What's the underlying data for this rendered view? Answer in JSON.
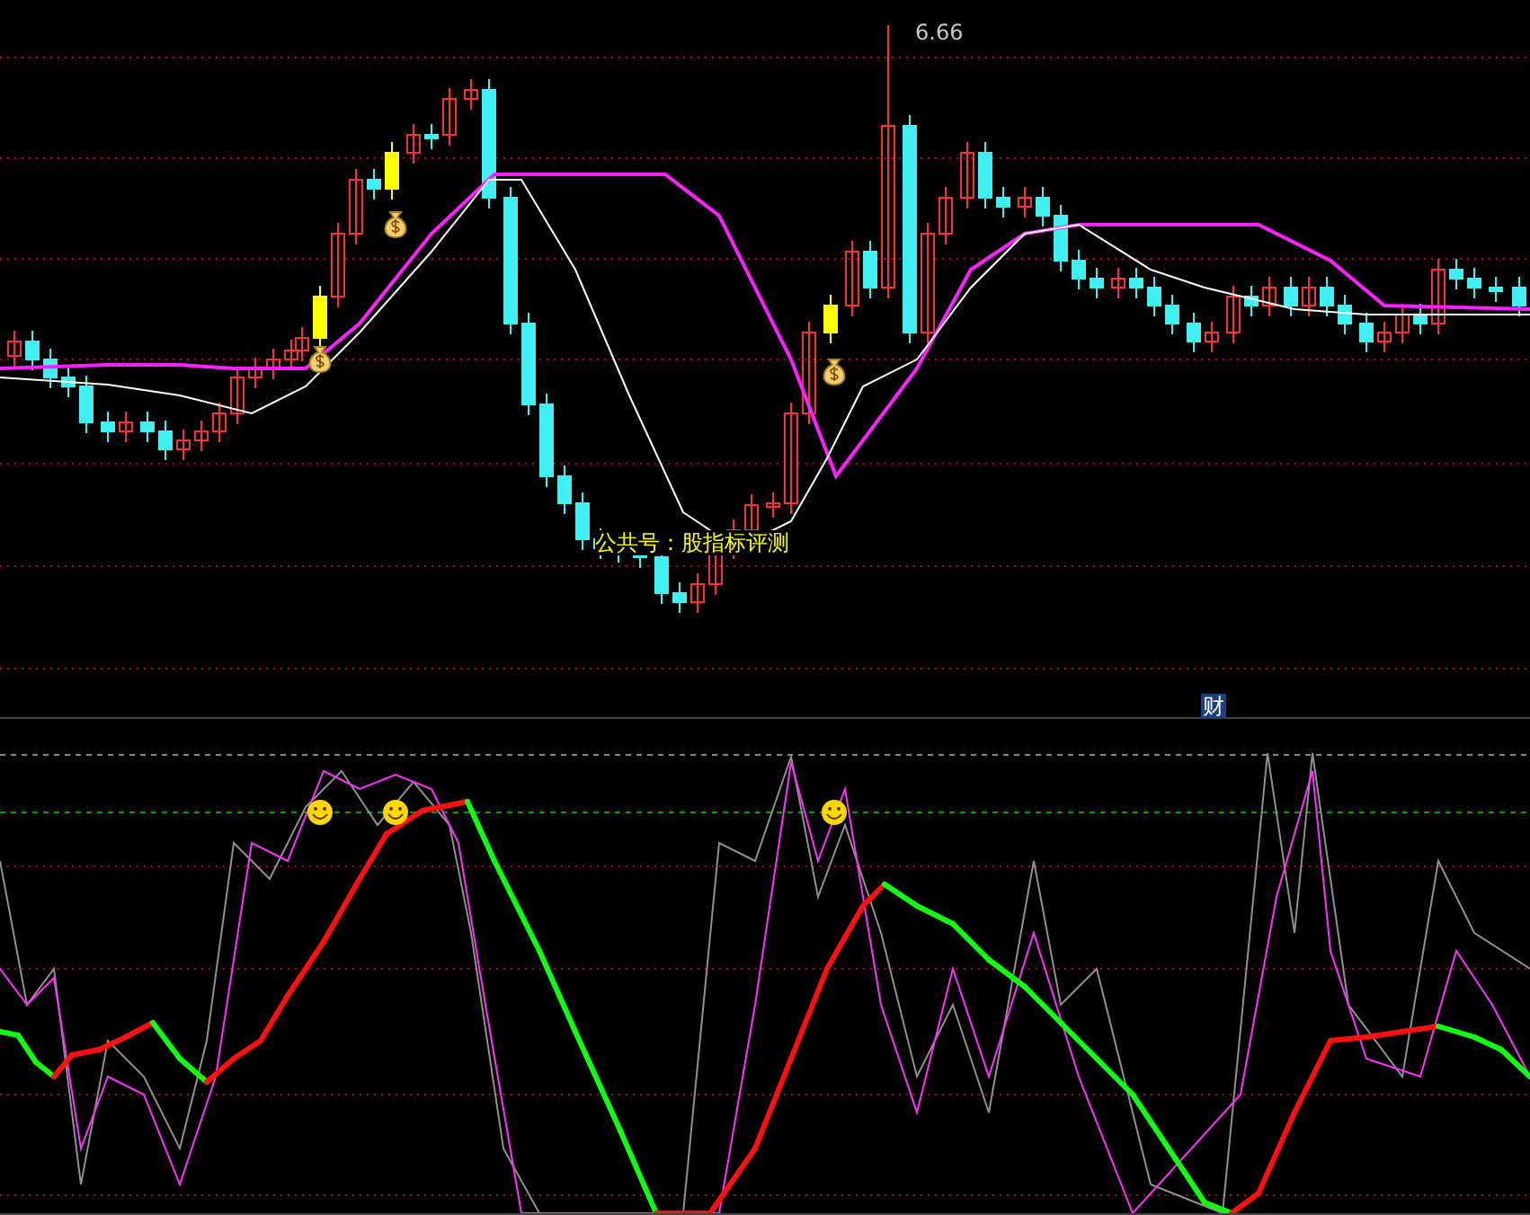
{
  "upper_panel": {
    "high_price": "6.66",
    "overlay_text": "公共号：股指标评测",
    "badge": "财"
  }
}
